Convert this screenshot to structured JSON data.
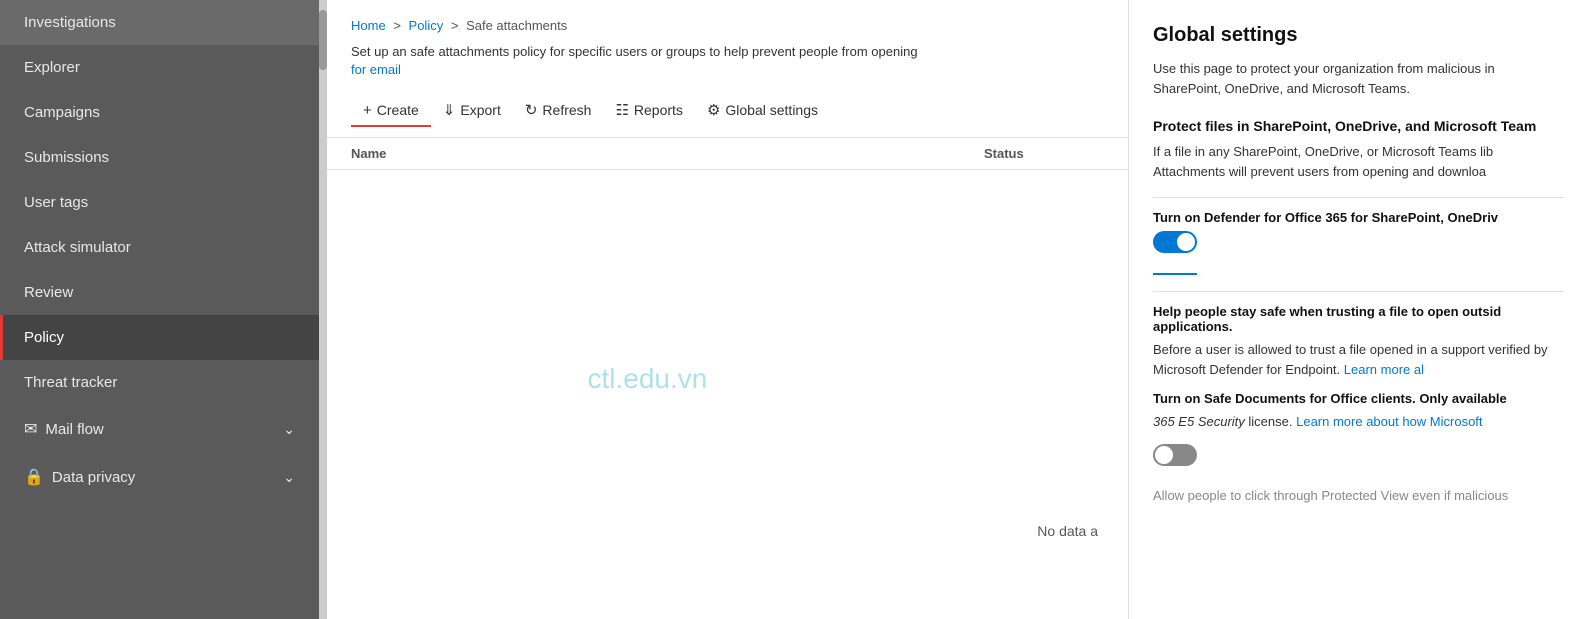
{
  "sidebar": {
    "items": [
      {
        "id": "investigations",
        "label": "Investigations",
        "active": false,
        "hasIcon": false,
        "hasChevron": false
      },
      {
        "id": "explorer",
        "label": "Explorer",
        "active": false,
        "hasIcon": false,
        "hasChevron": false
      },
      {
        "id": "campaigns",
        "label": "Campaigns",
        "active": false,
        "hasIcon": false,
        "hasChevron": false
      },
      {
        "id": "submissions",
        "label": "Submissions",
        "active": false,
        "hasIcon": false,
        "hasChevron": false
      },
      {
        "id": "user-tags",
        "label": "User tags",
        "active": false,
        "hasIcon": false,
        "hasChevron": false
      },
      {
        "id": "attack-simulator",
        "label": "Attack simulator",
        "active": false,
        "hasIcon": false,
        "hasChevron": false
      },
      {
        "id": "review",
        "label": "Review",
        "active": false,
        "hasIcon": false,
        "hasChevron": false
      },
      {
        "id": "policy",
        "label": "Policy",
        "active": true,
        "hasIcon": false,
        "hasChevron": false
      },
      {
        "id": "threat-tracker",
        "label": "Threat tracker",
        "active": false,
        "hasIcon": false,
        "hasChevron": false
      },
      {
        "id": "mail-flow",
        "label": "Mail flow",
        "active": false,
        "hasIcon": true,
        "hasChevron": true
      },
      {
        "id": "data-privacy",
        "label": "Data privacy",
        "active": false,
        "hasIcon": true,
        "hasChevron": true
      }
    ]
  },
  "breadcrumb": {
    "home": "Home",
    "policy": "Policy",
    "current": "Safe attachments",
    "sep1": ">",
    "sep2": ">"
  },
  "description": {
    "text": "Set up an safe attachments policy for specific users or groups to help prevent people from opening",
    "link": "for email"
  },
  "toolbar": {
    "create": "Create",
    "export": "Export",
    "refresh": "Refresh",
    "reports": "Reports",
    "global_settings": "Global settings"
  },
  "table": {
    "col_name": "Name",
    "col_status": "Status",
    "no_data": "No data a"
  },
  "watermark": {
    "text": "ctl.edu.vn"
  },
  "panel": {
    "title": "Global settings",
    "description": "Use this page to protect your organization from malicious in SharePoint, OneDrive, and Microsoft Teams.",
    "section1": {
      "title": "Protect files in SharePoint, OneDrive, and Microsoft Team",
      "description": "If a file in any SharePoint, OneDrive, or Microsoft Teams lib Attachments will prevent users from opening and downloa"
    },
    "section2": {
      "title": "Turn on Defender for Office 365 for SharePoint, OneDriv",
      "toggle_state": "on"
    },
    "section3": {
      "title": "Help people stay safe when trusting a file to open outsid applications.",
      "description": "Before a user is allowed to trust a file opened in a support verified by Microsoft Defender for Endpoint.",
      "link": "Learn more al"
    },
    "section4": {
      "title_part1": "Turn on Safe Documents for Office clients.",
      "title_part2": "Only available",
      "italic_text": "365 E5 Security",
      "title_part3": "license.",
      "link": "Learn more about how Microsoft",
      "toggle_state": "off"
    },
    "section5": {
      "description": "Allow people to click through Protected View even if malicious"
    }
  }
}
